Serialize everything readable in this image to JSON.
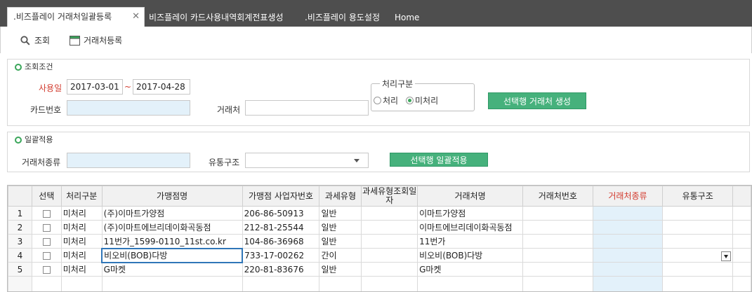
{
  "tabs": [
    {
      "label": ".비즈플레이 거래처일괄등록",
      "active": true
    },
    {
      "label": "비즈플레이 카드사용내역회계전표생성"
    },
    {
      "label": ".비즈플레이 용도설정"
    },
    {
      "label": "Home"
    }
  ],
  "toolbar": {
    "search_label": "조회",
    "register_label": "거래처등록"
  },
  "search_section": {
    "title": "조회조건",
    "date_label": "사용일",
    "date_from": "2017-03-01",
    "date_sep": "~",
    "date_to": "2017-04-28",
    "card_label": "카드번호",
    "card_value": "",
    "vendor_label": "거래처",
    "vendor_value": "",
    "process_group_title": "처리구분",
    "radio_processed": "처리",
    "radio_unprocessed": "미처리",
    "selected_radio": "미처리",
    "create_button": "선택행 거래처 생성"
  },
  "batch_section": {
    "title": "일괄적용",
    "vendor_type_label": "거래처종류",
    "vendor_type_value": "",
    "distribution_label": "유통구조",
    "distribution_value": "",
    "apply_button": "선택행 일괄적용"
  },
  "grid": {
    "columns": [
      "",
      "선택",
      "처리구분",
      "가맹점명",
      "가맹점 사업자번호",
      "과세유형",
      "과세유형조회일자",
      "거래처명",
      "거래처번호",
      "거래처종류",
      "유통구조"
    ],
    "rows": [
      {
        "no": "1",
        "status": "미처리",
        "merchant": "(주)이마트가양점",
        "bizno": "206-86-50913",
        "tax": "일반",
        "taxdate": "",
        "vendor": "이마트가양점",
        "vendorno": "",
        "vtype": "",
        "dist": ""
      },
      {
        "no": "2",
        "status": "미처리",
        "merchant": "(주)이마트에브리데이화곡동점",
        "bizno": "212-81-25544",
        "tax": "일반",
        "taxdate": "",
        "vendor": "이마트에브리데이화곡동점",
        "vendorno": "",
        "vtype": "",
        "dist": ""
      },
      {
        "no": "3",
        "status": "미처리",
        "merchant": "11번가_1599-0110_11st.co.kr",
        "bizno": "104-86-36968",
        "tax": "일반",
        "taxdate": "",
        "vendor": "11번가",
        "vendorno": "",
        "vtype": "",
        "dist": ""
      },
      {
        "no": "4",
        "status": "미처리",
        "merchant": "비오비(BOB)다방",
        "bizno": "733-17-00262",
        "tax": "간이",
        "taxdate": "",
        "vendor": "비오비(BOB)다방",
        "vendorno": "",
        "vtype": "",
        "dist": ""
      },
      {
        "no": "5",
        "status": "미처리",
        "merchant": "G마켓",
        "bizno": "220-81-83676",
        "tax": "일반",
        "taxdate": "",
        "vendor": "G마켓",
        "vendorno": "",
        "vtype": "",
        "dist": ""
      }
    ]
  },
  "colors": {
    "accent_green": "#46b17c",
    "tab_bar": "#4e4e4e",
    "required_red": "#d23b2e",
    "input_blue": "#e3f1fa"
  }
}
